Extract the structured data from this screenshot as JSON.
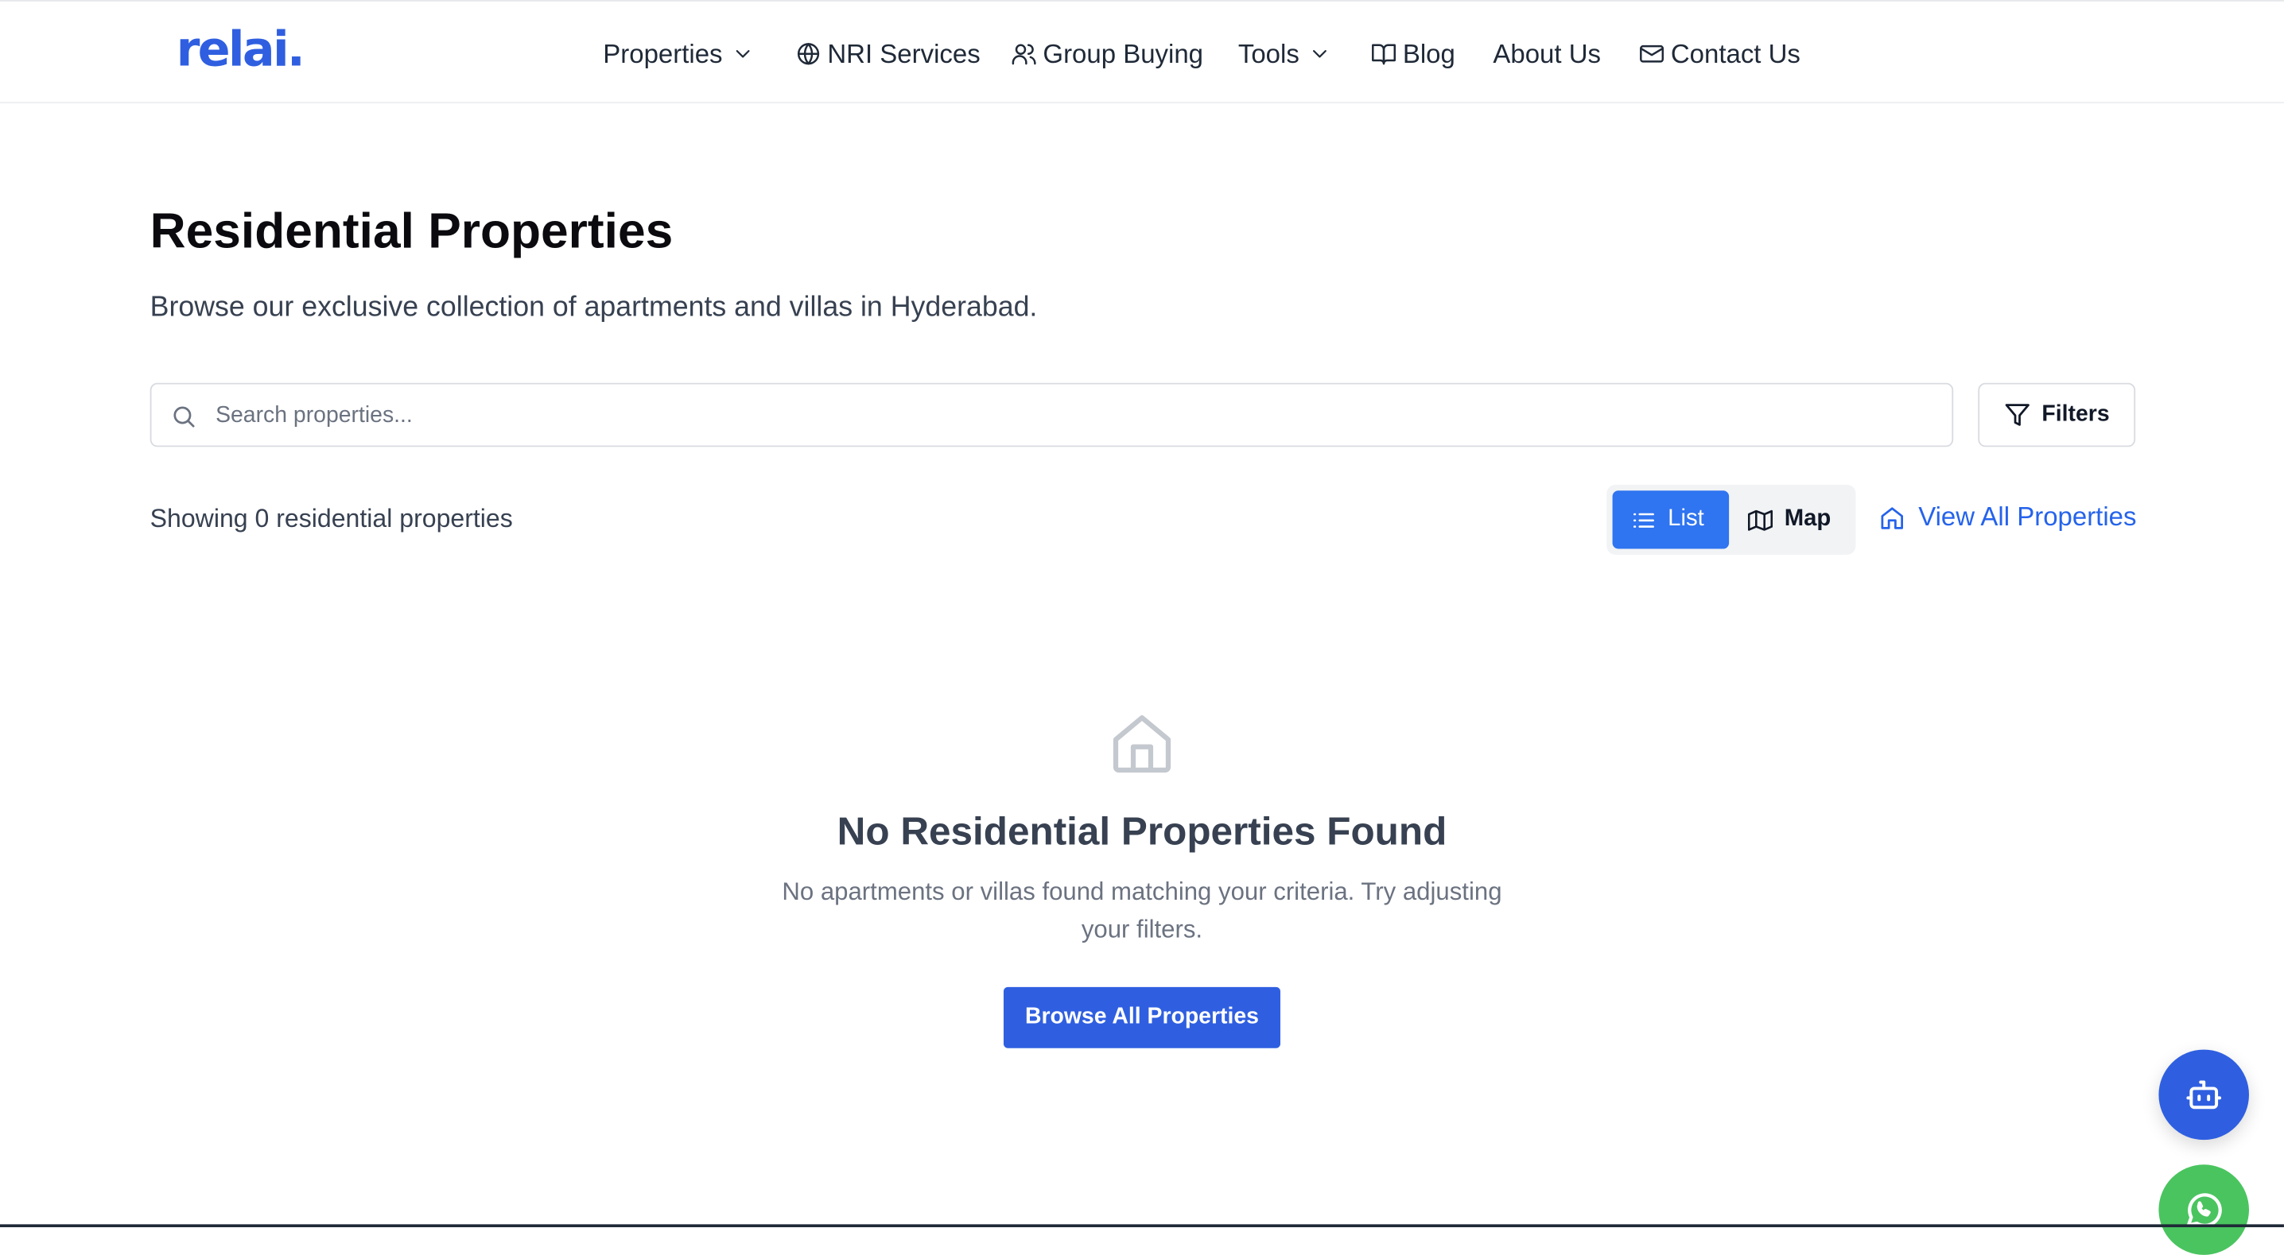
{
  "brand": {
    "logo": "relai.",
    "color": "#2f5fe0"
  },
  "nav": {
    "items": [
      {
        "label": "Properties",
        "icon": "chevron-down-icon"
      },
      {
        "label": "NRI Services",
        "icon": "globe-icon"
      },
      {
        "label": "Group Buying",
        "icon": "users-icon"
      },
      {
        "label": "Tools",
        "icon": "chevron-down-icon"
      },
      {
        "label": "Blog",
        "icon": "book-icon"
      },
      {
        "label": "About Us"
      },
      {
        "label": "Contact Us",
        "icon": "mail-icon"
      }
    ]
  },
  "main": {
    "title": "Residential Properties",
    "subtitle": "Browse our exclusive collection of apartments and villas in Hyderabad.",
    "search": {
      "placeholder": "Search properties...",
      "value": "",
      "icon": "search-icon"
    },
    "filters_label": "Filters",
    "count_text": "Showing 0 residential properties",
    "view_toggle": {
      "list_label": "List",
      "map_label": "Map",
      "active": "List"
    },
    "view_all_label": "View All Properties",
    "empty": {
      "icon": "house-icon",
      "title": "No Residential Properties Found",
      "text": "No apartments or villas found matching your criteria. Try adjusting your filters.",
      "button_label": "Browse All Properties"
    }
  },
  "floating": {
    "bot_icon": "bot-icon",
    "whatsapp_icon": "whatsapp-icon"
  },
  "colors": {
    "accent": "#2f5fe0",
    "toggle_active": "#2f74f0",
    "link": "#2563eb",
    "whatsapp": "#4ac45f"
  }
}
